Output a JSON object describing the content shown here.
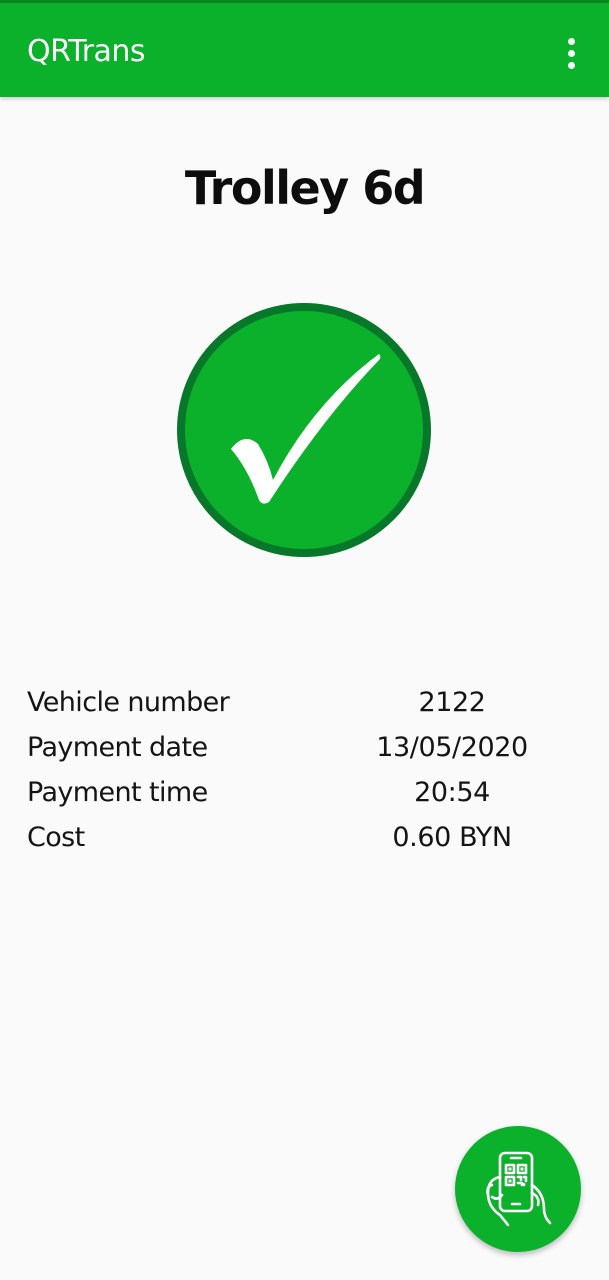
{
  "app": {
    "title": "QRTrans",
    "menu_icon": "more-vert-icon",
    "brand_color": "#0bb12a"
  },
  "ticket": {
    "route": "Trolley 6d",
    "status_icon": "check-circle-icon",
    "status_color": "#0bb12a",
    "details": [
      {
        "label": "Vehicle number",
        "value": "2122"
      },
      {
        "label": "Payment date",
        "value": "13/05/2020"
      },
      {
        "label": "Payment time",
        "value": "20:54"
      },
      {
        "label": "Cost",
        "value": "0.60 BYN"
      }
    ]
  },
  "fab": {
    "icon": "phone-qr-scan-icon"
  }
}
